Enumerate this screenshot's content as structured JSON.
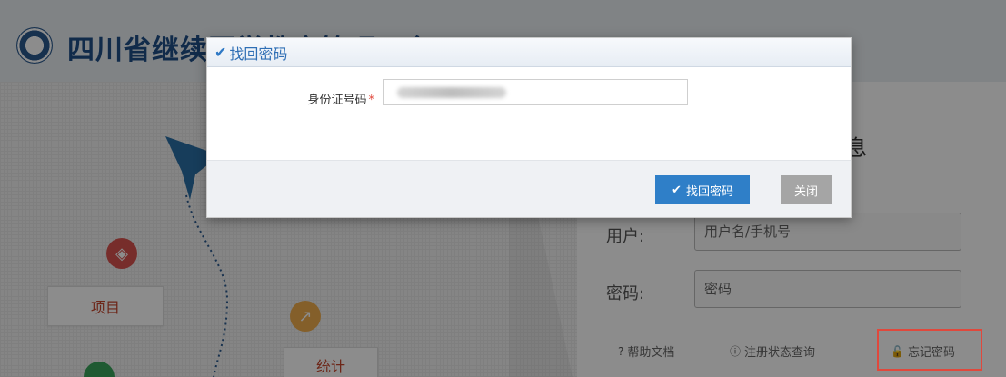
{
  "header": {
    "site_title": "四川省继续医学教育管理平台"
  },
  "background": {
    "project_label": "项目",
    "stats_label": "统计",
    "login_title_fragment": "息",
    "user_label": "用户:",
    "user_placeholder": "用户名/手机号",
    "password_label": "密码:",
    "password_placeholder": "密码",
    "links": {
      "help_doc": "帮助文档",
      "registration_status": "注册状态查询",
      "forgot_password": "忘记密码"
    }
  },
  "modal": {
    "title": "找回密码",
    "id_label": "身份证号码",
    "required_mark": "*",
    "submit_label": "找回密码",
    "close_label": "关闭"
  },
  "colors": {
    "primary": "#2f7fc8",
    "highlight": "#e0483c",
    "title_blue": "#1f4f88"
  }
}
